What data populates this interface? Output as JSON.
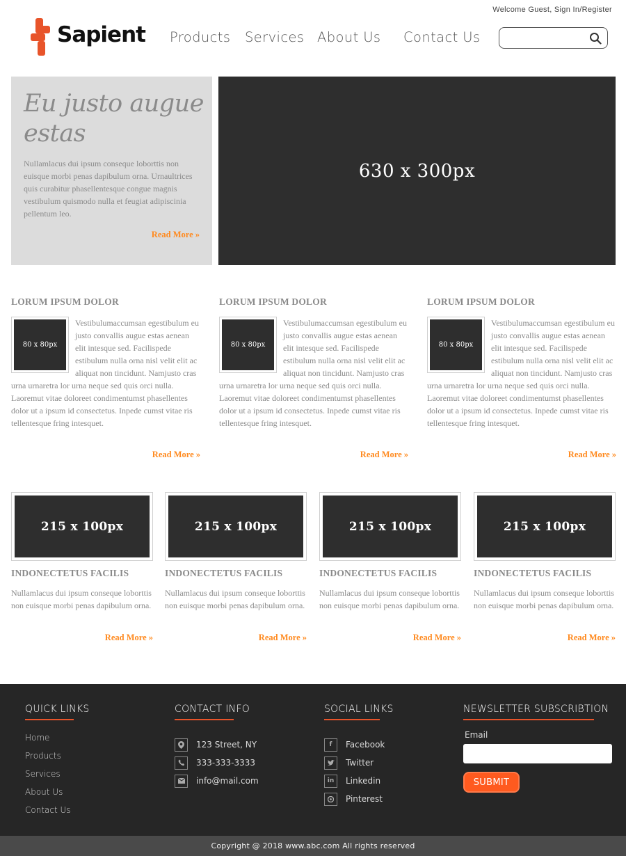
{
  "header": {
    "welcome": "Welcome Guest, Sign In/Register",
    "logo_text": "Sapient",
    "nav": [
      "Products",
      "Services",
      "About Us",
      "Contact Us"
    ],
    "search_placeholder": ""
  },
  "hero": {
    "title": "Eu justo augue estas",
    "text": "Nullamlacus dui ipsum conseque loborttis non euisque morbi penas dapibulum orna. Urnaultrices quis curabitur phasellentesque congue magnis vestibulum quismodo nulla et feugiat adipiscinia pellentum leo.",
    "read_more": "Read More »",
    "image_label": "630 x 300px"
  },
  "articles": [
    {
      "title": "LORUM IPSUM DOLOR",
      "thumb": "80 x 80px",
      "text": "Vestibulumaccumsan egestibulum eu justo convallis augue estas aenean elit intesque sed. Facilispede estibulum nulla orna nisl velit elit ac aliquat non tincidunt. Namjusto cras urna urnaretra lor urna neque sed quis orci nulla. Laoremut vitae doloreet condimentumst phasellentes dolor ut a ipsum id consectetus. Inpede cumst vitae ris tellentesque fring intesquet.",
      "read_more": "Read More »"
    },
    {
      "title": "LORUM IPSUM DOLOR",
      "thumb": "80 x 80px",
      "text": "Vestibulumaccumsan egestibulum eu justo convallis augue estas aenean elit intesque sed. Facilispede estibulum nulla orna nisl velit elit ac aliquat non tincidunt. Namjusto cras urna urnaretra lor urna neque sed quis orci nulla. Laoremut vitae doloreet condimentumst phasellentes dolor ut a ipsum id consectetus. Inpede cumst vitae ris tellentesque fring intesquet.",
      "read_more": "Read More »"
    },
    {
      "title": "LORUM IPSUM DOLOR",
      "thumb": "80 x 80px",
      "text": "Vestibulumaccumsan egestibulum eu justo convallis augue estas aenean elit intesque sed. Facilispede estibulum nulla orna nisl velit elit ac aliquat non tincidunt. Namjusto cras urna urnaretra lor urna neque sed quis orci nulla. Laoremut vitae doloreet condimentumst phasellentes dolor ut a ipsum id consectetus. Inpede cumst vitae ris tellentesque fring intesquet.",
      "read_more": "Read More »"
    }
  ],
  "cards": [
    {
      "image": "215 x 100px",
      "title": "INDONECTETUS FACILIS",
      "text": "Nullamlacus dui ipsum conseque loborttis non euisque morbi penas dapibulum orna.",
      "read_more": "Read More »"
    },
    {
      "image": "215 x 100px",
      "title": "INDONECTETUS FACILIS",
      "text": "Nullamlacus dui ipsum conseque loborttis non euisque morbi penas dapibulum orna.",
      "read_more": "Read More »"
    },
    {
      "image": "215 x 100px",
      "title": "INDONECTETUS FACILIS",
      "text": "Nullamlacus dui ipsum conseque loborttis non euisque morbi penas dapibulum orna.",
      "read_more": "Read More »"
    },
    {
      "image": "215 x 100px",
      "title": "INDONECTETUS FACILIS",
      "text": "Nullamlacus dui ipsum conseque loborttis non euisque morbi penas dapibulum orna.",
      "read_more": "Read More »"
    }
  ],
  "footer": {
    "quick_links": {
      "heading": "QUICK LINKS",
      "items": [
        "Home",
        "Products",
        "Services",
        "About Us",
        "Contact Us"
      ]
    },
    "contact_info": {
      "heading": "CONTACT INFO",
      "items": [
        {
          "icon": "map-marker-icon",
          "text": "123 Street, NY"
        },
        {
          "icon": "phone-icon",
          "text": "333-333-3333"
        },
        {
          "icon": "envelope-icon",
          "text": "info@mail.com"
        }
      ]
    },
    "social_links": {
      "heading": "SOCIAL LINKS",
      "items": [
        {
          "icon": "facebook-icon",
          "text": "Facebook"
        },
        {
          "icon": "twitter-icon",
          "text": "Twitter"
        },
        {
          "icon": "linkedin-icon",
          "text": "Linkedin"
        },
        {
          "icon": "pinterest-icon",
          "text": "Pinterest"
        }
      ]
    },
    "newsletter": {
      "heading": "NEWSLETTER SUBSCRIBTION",
      "email_label": "Email",
      "submit_label": "SUBMIT"
    },
    "copyright": "Copyright @ 2018 www.abc.com All rights reserved"
  },
  "colors": {
    "accent": "#ff8a1f",
    "brand": "#e8542a",
    "footer_bg": "#262626",
    "copyright_bg": "#4a4a4a",
    "placeholder_bg": "#2e2e2e",
    "hero_box_bg": "#dcdcdc"
  }
}
